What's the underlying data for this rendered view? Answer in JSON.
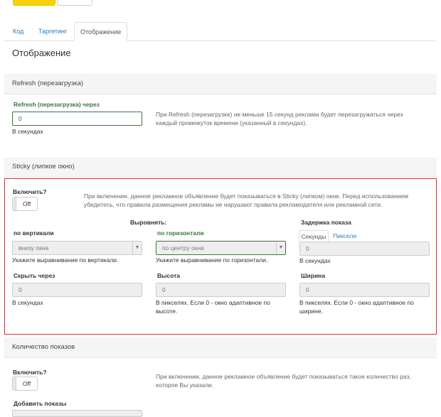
{
  "top_buttons": {
    "primary_label": "",
    "secondary_label": ""
  },
  "tabs": [
    {
      "label": "Код"
    },
    {
      "label": "Таргетинг"
    },
    {
      "label": "Отображение",
      "active": true
    }
  ],
  "page_title": "Отображение",
  "refresh": {
    "header": "Refresh (перезагрузка)",
    "field_label": "Refresh (перезагрузка) через",
    "value": "0",
    "help": "В секундах",
    "description": "При Refresh (перезагрузке) не меньше 15 секунд реклама будет перезагружаться через каждый промежуток времени (указанный в секундах)."
  },
  "sticky": {
    "header": "Sticky (липкое окно)",
    "enable_label": "Включить?",
    "toggle_text": "Off",
    "description": "При включении, данное рекламное объявление будет показываться в Sticky (липком) окне. Перед использованием убедитесь, что правила размещения рекламы не нарушают правила рекламодателя или рекламной сети.",
    "align_label": "Выровнять:",
    "vertical": {
      "label": "по вертикали",
      "value": "внизу окна",
      "help": "Укажите выравнивание по вертикали."
    },
    "horizontal": {
      "label": "по горизонтали",
      "value": "по центру окна",
      "help": "Укажите выравнивание по горизонтали."
    },
    "delay": {
      "label": "Задержка показа",
      "tab_seconds": "Секунды",
      "tab_pixels": "Пиксели",
      "value": "0",
      "help": "В секундах"
    },
    "hide": {
      "label": "Скрыть через",
      "value": "0",
      "help": "В секундах"
    },
    "height": {
      "label": "Высота",
      "value": "0",
      "help": "В пикселях. Если 0 - окно адаптивное по высоте."
    },
    "width": {
      "label": "Ширина",
      "value": "0",
      "help": "В пикселях. Если 0 - окно адаптивное по ширине."
    }
  },
  "impressions": {
    "header": "Количество показов",
    "enable_label": "Включить?",
    "toggle_text": "Off",
    "description": "При включении, данное рекламное объявление будет показываться такое количество раз, которое Вы указали.",
    "add_label": "Добавить показы"
  },
  "colors": {
    "accent_yellow": "#f5d10d",
    "link_blue": "#337ab7",
    "valid_green": "#3c763d",
    "error_red": "#a94442"
  }
}
